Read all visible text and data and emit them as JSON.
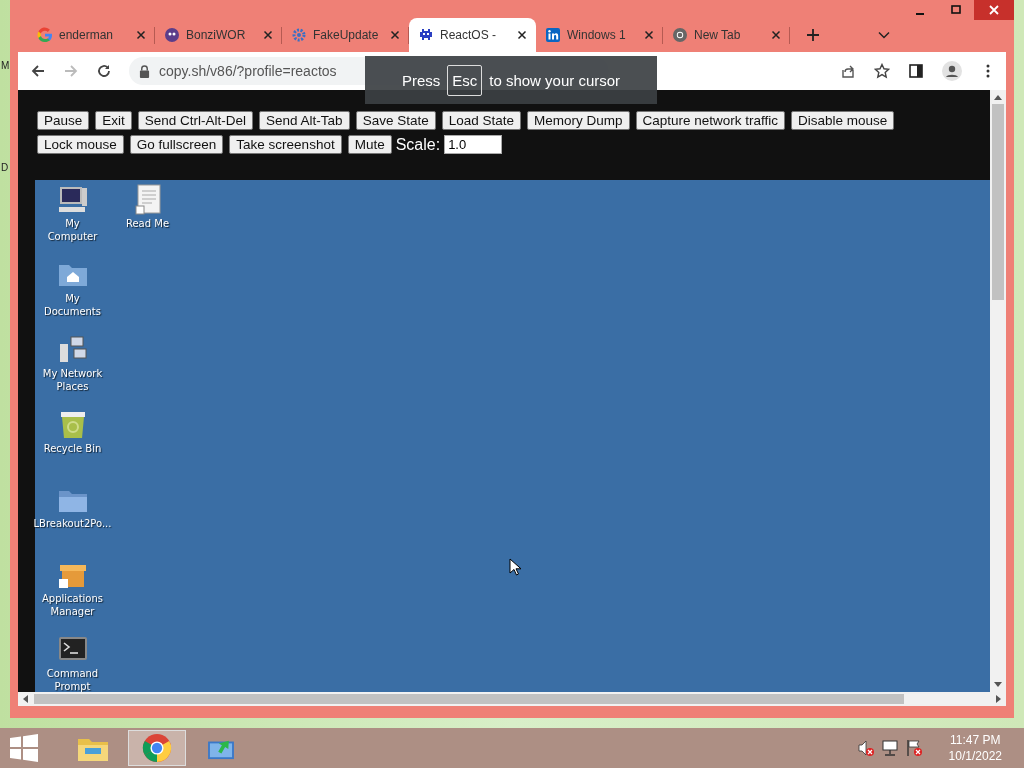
{
  "desktop_edge_labels": [
    "M",
    "D"
  ],
  "tabs": [
    {
      "title": "enderman",
      "kind": "google",
      "selected": false
    },
    {
      "title": "BonziWOR",
      "kind": "bonzi",
      "selected": false
    },
    {
      "title": "FakeUpdate",
      "kind": "gear",
      "selected": false
    },
    {
      "title": "ReactOS -",
      "kind": "invader",
      "selected": true
    },
    {
      "title": "Windows 1",
      "kind": "linkedin",
      "selected": false
    },
    {
      "title": "New Tab",
      "kind": "chrome",
      "selected": false
    }
  ],
  "address_bar": {
    "url": "copy.sh/v86/?profile=reactos"
  },
  "cursor_notice": {
    "before": "Press",
    "key": "Esc",
    "after": "to show your cursor"
  },
  "button_rows": [
    [
      "Pause",
      "Exit",
      "Send Ctrl-Alt-Del",
      "Send Alt-Tab",
      "Save State",
      "Load State",
      "Memory Dump",
      "Capture network traffic",
      "Disable mouse"
    ],
    [
      "Lock mouse",
      "Go fullscreen",
      "Take screenshot",
      "Mute"
    ]
  ],
  "scale": {
    "label": "Scale:",
    "value": "1.0"
  },
  "desktop": {
    "columns": [
      [
        {
          "label": "My Computer",
          "kind": "computer"
        },
        {
          "label": "My Documents",
          "kind": "documents"
        },
        {
          "label": "My Network Places",
          "kind": "network"
        },
        {
          "label": "Recycle Bin",
          "kind": "recycle"
        },
        {
          "label": "LBreakout2Po...",
          "kind": "folder"
        },
        {
          "label": "Applications Manager",
          "kind": "package"
        },
        {
          "label": "Command Prompt",
          "kind": "terminal"
        }
      ],
      [
        {
          "label": "Read Me",
          "kind": "document"
        }
      ]
    ]
  },
  "taskbar": {
    "apps": [
      {
        "kind": "explorer",
        "selected": false
      },
      {
        "kind": "chrome",
        "selected": true
      },
      {
        "kind": "installer",
        "selected": false
      }
    ],
    "time": "11:47 PM",
    "date": "10/1/2022"
  }
}
